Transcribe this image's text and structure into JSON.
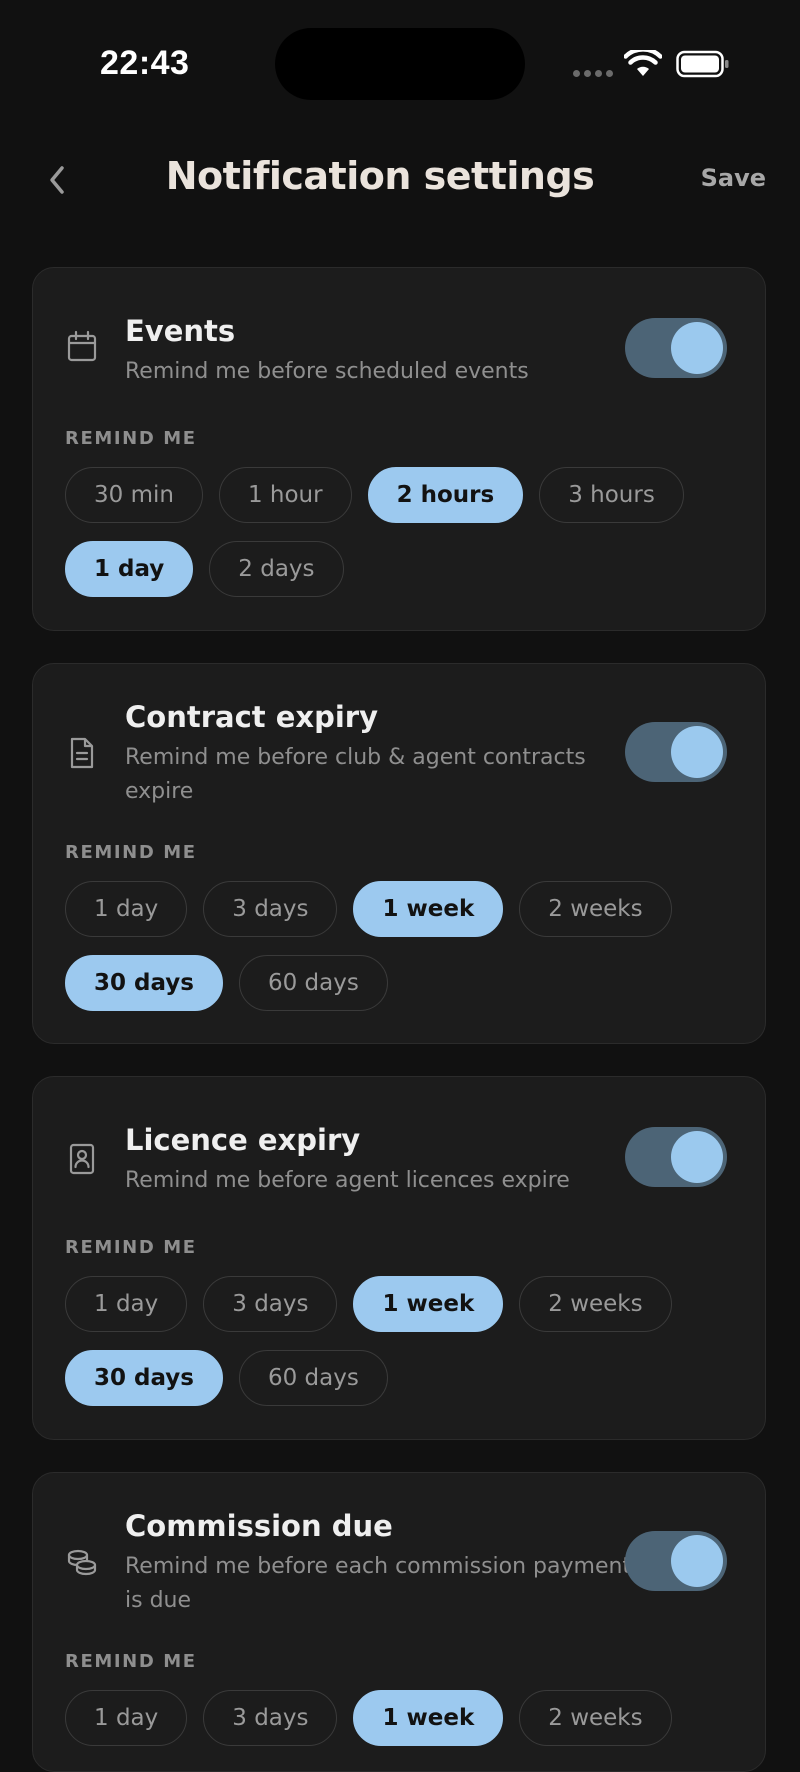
{
  "status_bar": {
    "time": "22:43"
  },
  "header": {
    "title": "Notification settings",
    "save_label": "Save"
  },
  "cards": [
    {
      "icon": "calendar-icon",
      "title": "Events",
      "description": "Remind me before scheduled events",
      "enabled": true,
      "remind_label": "REMIND ME",
      "options": [
        {
          "label": "30 min",
          "selected": false
        },
        {
          "label": "1 hour",
          "selected": false
        },
        {
          "label": "2 hours",
          "selected": true
        },
        {
          "label": "3 hours",
          "selected": false
        },
        {
          "label": "1 day",
          "selected": true
        },
        {
          "label": "2 days",
          "selected": false
        }
      ]
    },
    {
      "icon": "document-icon",
      "title": "Contract expiry",
      "description": "Remind me before club & agent contracts expire",
      "enabled": true,
      "remind_label": "REMIND ME",
      "options": [
        {
          "label": "1 day",
          "selected": false
        },
        {
          "label": "3 days",
          "selected": false
        },
        {
          "label": "1 week",
          "selected": true
        },
        {
          "label": "2 weeks",
          "selected": false
        },
        {
          "label": "30 days",
          "selected": true
        },
        {
          "label": "60 days",
          "selected": false
        }
      ]
    },
    {
      "icon": "id-badge-icon",
      "title": "Licence expiry",
      "description": "Remind me before agent licences expire",
      "enabled": true,
      "remind_label": "REMIND ME",
      "options": [
        {
          "label": "1 day",
          "selected": false
        },
        {
          "label": "3 days",
          "selected": false
        },
        {
          "label": "1 week",
          "selected": true
        },
        {
          "label": "2 weeks",
          "selected": false
        },
        {
          "label": "30 days",
          "selected": true
        },
        {
          "label": "60 days",
          "selected": false
        }
      ]
    },
    {
      "icon": "coins-icon",
      "title": "Commission due",
      "description": "Remind me before each commission payment is due",
      "enabled": true,
      "remind_label": "REMIND ME",
      "options": [
        {
          "label": "1 day",
          "selected": false
        },
        {
          "label": "3 days",
          "selected": false
        },
        {
          "label": "1 week",
          "selected": true
        },
        {
          "label": "2 weeks",
          "selected": false
        }
      ]
    }
  ]
}
